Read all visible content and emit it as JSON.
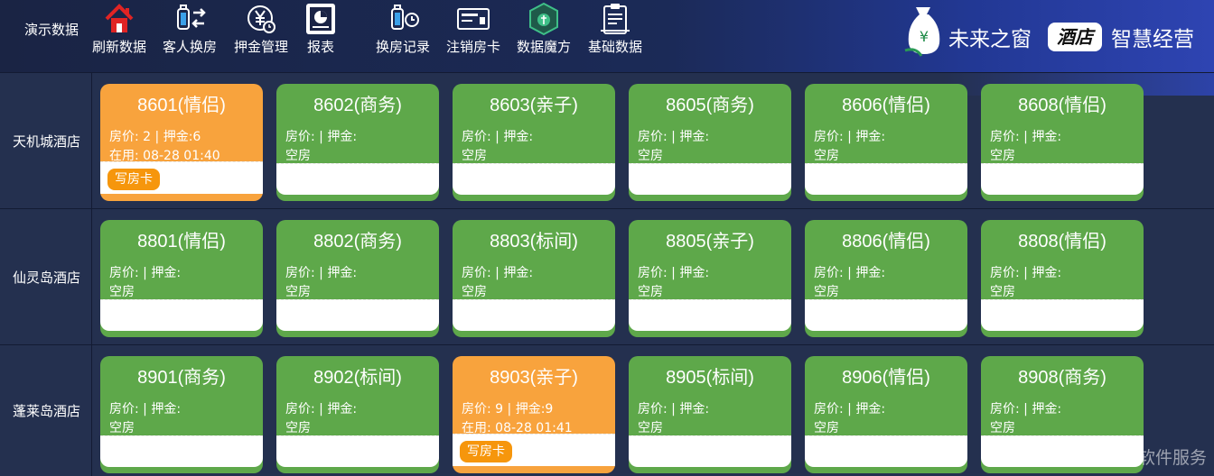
{
  "header": {
    "demo_label": "演示数据",
    "tools": [
      {
        "label": "刷新数据",
        "icon": "home-refresh-icon"
      },
      {
        "label": "客人换房",
        "icon": "luggage-swap-icon"
      },
      {
        "label": "押金管理",
        "icon": "yen-deposit-icon"
      },
      {
        "label": "报表",
        "icon": "report-icon"
      },
      {
        "label": "换房记录",
        "icon": "luggage-history-icon"
      },
      {
        "label": "注销房卡",
        "icon": "room-card-icon"
      },
      {
        "label": "数据魔方",
        "icon": "data-cube-icon"
      },
      {
        "label": "基础数据",
        "icon": "clipboard-icon"
      }
    ],
    "brand": {
      "name": "未来之窗",
      "badge": "酒店",
      "slogan": "智慧经营",
      "logo_icon": "money-bag-logo-icon"
    }
  },
  "colors": {
    "vacant": "#5ea84a",
    "occupied": "#f8a33d",
    "write_card": "#f6960c",
    "background": "#24304f"
  },
  "hotels": [
    {
      "name": "天机城酒店",
      "rooms": [
        {
          "number": "8601(情侣)",
          "price_line": "房价: 2 | 押金:6",
          "status": "在用:  08-28 01:40",
          "occupied": true,
          "action": "写房卡"
        },
        {
          "number": "8602(商务)",
          "price_line": "房价: | 押金:",
          "status": "空房",
          "occupied": false
        },
        {
          "number": "8603(亲子)",
          "price_line": "房价: | 押金:",
          "status": "空房",
          "occupied": false
        },
        {
          "number": "8605(商务)",
          "price_line": "房价: | 押金:",
          "status": "空房",
          "occupied": false
        },
        {
          "number": "8606(情侣)",
          "price_line": "房价: | 押金:",
          "status": "空房",
          "occupied": false
        },
        {
          "number": "8608(情侣)",
          "price_line": "房价: | 押金:",
          "status": "空房",
          "occupied": false
        }
      ]
    },
    {
      "name": "仙灵岛酒店",
      "rooms": [
        {
          "number": "8801(情侣)",
          "price_line": "房价: | 押金:",
          "status": "空房",
          "occupied": false
        },
        {
          "number": "8802(商务)",
          "price_line": "房价: | 押金:",
          "status": "空房",
          "occupied": false
        },
        {
          "number": "8803(标间)",
          "price_line": "房价: | 押金:",
          "status": "空房",
          "occupied": false
        },
        {
          "number": "8805(亲子)",
          "price_line": "房价: | 押金:",
          "status": "空房",
          "occupied": false
        },
        {
          "number": "8806(情侣)",
          "price_line": "房价: | 押金:",
          "status": "空房",
          "occupied": false
        },
        {
          "number": "8808(情侣)",
          "price_line": "房价: | 押金:",
          "status": "空房",
          "occupied": false
        }
      ]
    },
    {
      "name": "蓬莱岛酒店",
      "rooms": [
        {
          "number": "8901(商务)",
          "price_line": "房价: | 押金:",
          "status": "空房",
          "occupied": false
        },
        {
          "number": "8902(标间)",
          "price_line": "房价: | 押金:",
          "status": "空房",
          "occupied": false
        },
        {
          "number": "8903(亲子)",
          "price_line": "房价: 9 | 押金:9",
          "status": "在用:  08-28 01:41",
          "occupied": true,
          "action": "写房卡"
        },
        {
          "number": "8905(标间)",
          "price_line": "房价: | 押金:",
          "status": "空房",
          "occupied": false
        },
        {
          "number": "8906(情侣)",
          "price_line": "房价: | 押金:",
          "status": "空房",
          "occupied": false
        },
        {
          "number": "8908(商务)",
          "price_line": "房价: | 押金:",
          "status": "空房",
          "occupied": false
        }
      ]
    }
  ],
  "watermark": "CSDN @未来之窗软件服务"
}
